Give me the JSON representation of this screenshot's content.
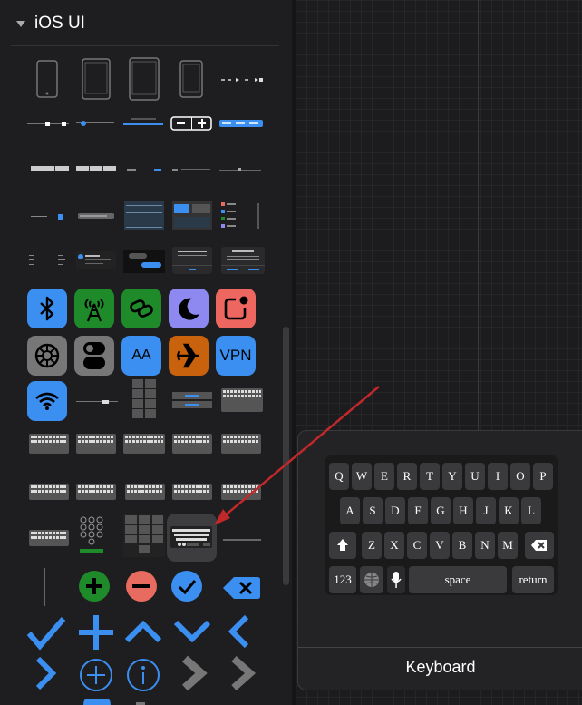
{
  "panel": {
    "section_title": "iOS UI",
    "icons": [
      "bluetooth-icon",
      "antenna-icon",
      "link-icon",
      "moon-icon",
      "notification-icon",
      "gear-icon",
      "toggle-icon",
      "text-size-icon",
      "airplane-icon",
      "vpn-icon",
      "wifi-icon",
      "add-circle-icon",
      "remove-circle-icon",
      "checkmark-circle-icon",
      "delete-key-icon",
      "checkmark-icon",
      "plus-icon",
      "chevron-up-icon",
      "chevron-down-icon",
      "chevron-left-icon",
      "chevron-right-icon",
      "add-outline-icon",
      "info-icon",
      "chevron-right-gray-icon"
    ],
    "vpn_label": "VPN",
    "text_size_label": "AA"
  },
  "keyboard_popup": {
    "title": "Keyboard",
    "row1": [
      "Q",
      "W",
      "E",
      "R",
      "T",
      "Y",
      "U",
      "I",
      "O",
      "P"
    ],
    "row2": [
      "A",
      "S",
      "D",
      "F",
      "G",
      "H",
      "J",
      "K",
      "L"
    ],
    "row3": [
      "Z",
      "X",
      "C",
      "V",
      "B",
      "N",
      "M"
    ],
    "numbers_key": "123",
    "space_key": "space",
    "return_key": "return"
  },
  "colors": {
    "blue": "#3a8ff0",
    "green": "#1f8a2a",
    "red": "#e76b5f",
    "orange": "#c9620d",
    "purple": "#8e89f0",
    "coral": "#ee6660",
    "arrow": "#c0282a"
  }
}
